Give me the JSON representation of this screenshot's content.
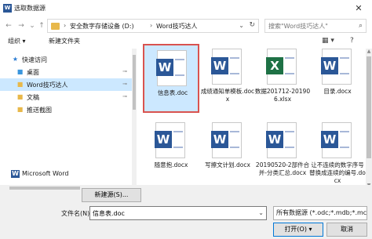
{
  "window": {
    "title": "选取数据源",
    "icon_letter": "W",
    "close_glyph": "✕"
  },
  "nav": {
    "back_glyph": "←",
    "forward_glyph": "→",
    "dropdown_glyph": "⌄",
    "up_glyph": "↑"
  },
  "address": {
    "crumbs": [
      "安全数字存储设备 (D:)",
      "Word技巧达人"
    ],
    "separator": "›",
    "dropdown_glyph": "⌄",
    "refresh_glyph": "↻"
  },
  "search": {
    "placeholder": "搜索\"Word技巧达人\"",
    "icon": "search-icon",
    "glyph": "⌕"
  },
  "toolbar": {
    "organize": "组织 ▾",
    "new_folder": "新建文件夹",
    "view_glyph": "▦ ▾",
    "help_glyph": "?"
  },
  "sidebar": {
    "items": [
      {
        "label": "快速访问",
        "icon": "star-icon",
        "glyph": "★",
        "color": "#2b7cd3",
        "pinned": false
      },
      {
        "label": "桌面",
        "icon": "desktop-folder-icon",
        "glyph": "■",
        "color": "#3a96dd",
        "pinned": true
      },
      {
        "label": "Word技巧达人",
        "icon": "folder-icon",
        "glyph": "■",
        "color": "#e8b84a",
        "pinned": true,
        "selected": true
      },
      {
        "label": "文稿",
        "icon": "folder-icon",
        "glyph": "■",
        "color": "#e8b84a",
        "pinned": true
      },
      {
        "label": "推送截图",
        "icon": "folder-icon",
        "glyph": "■",
        "color": "#e8b84a",
        "pinned": false
      },
      {
        "label": "Microsoft Word",
        "icon": "word-icon",
        "glyph": "W",
        "color": "#2b5797",
        "pinned": false
      }
    ],
    "pin_glyph": "⊸"
  },
  "files": [
    {
      "name": "信息表.doc",
      "type": "word",
      "selected": true
    },
    {
      "name": "成绩通知单模板.docx",
      "type": "word"
    },
    {
      "name": "数据201712-201906.xlsx",
      "type": "excel"
    },
    {
      "name": "目录.docx",
      "type": "word"
    },
    {
      "name": "随意抱.docx",
      "type": "word"
    },
    {
      "name": "写擦文计划.docx",
      "type": "word"
    },
    {
      "name": "20190520-2部件合并-分类汇总.docx",
      "type": "word"
    },
    {
      "name": "让不连续的数字序号替换成连续的编号.docx",
      "type": "word"
    }
  ],
  "footer": {
    "new_source_button": "新建源(S)...",
    "filename_label": "文件名(N):",
    "filename_value": "信息表.doc",
    "filetype_value": "所有数据源 (*.odc;*.mdb;*.mc",
    "open_button": "打开(O)",
    "open_dropdown": "▾",
    "cancel_button": "取消",
    "dropdown_glyph": "⌄"
  },
  "colors": {
    "selection": "#cce8ff",
    "selected_border": "#d9534f",
    "word_blue": "#2b5797",
    "excel_green": "#1e7145"
  }
}
